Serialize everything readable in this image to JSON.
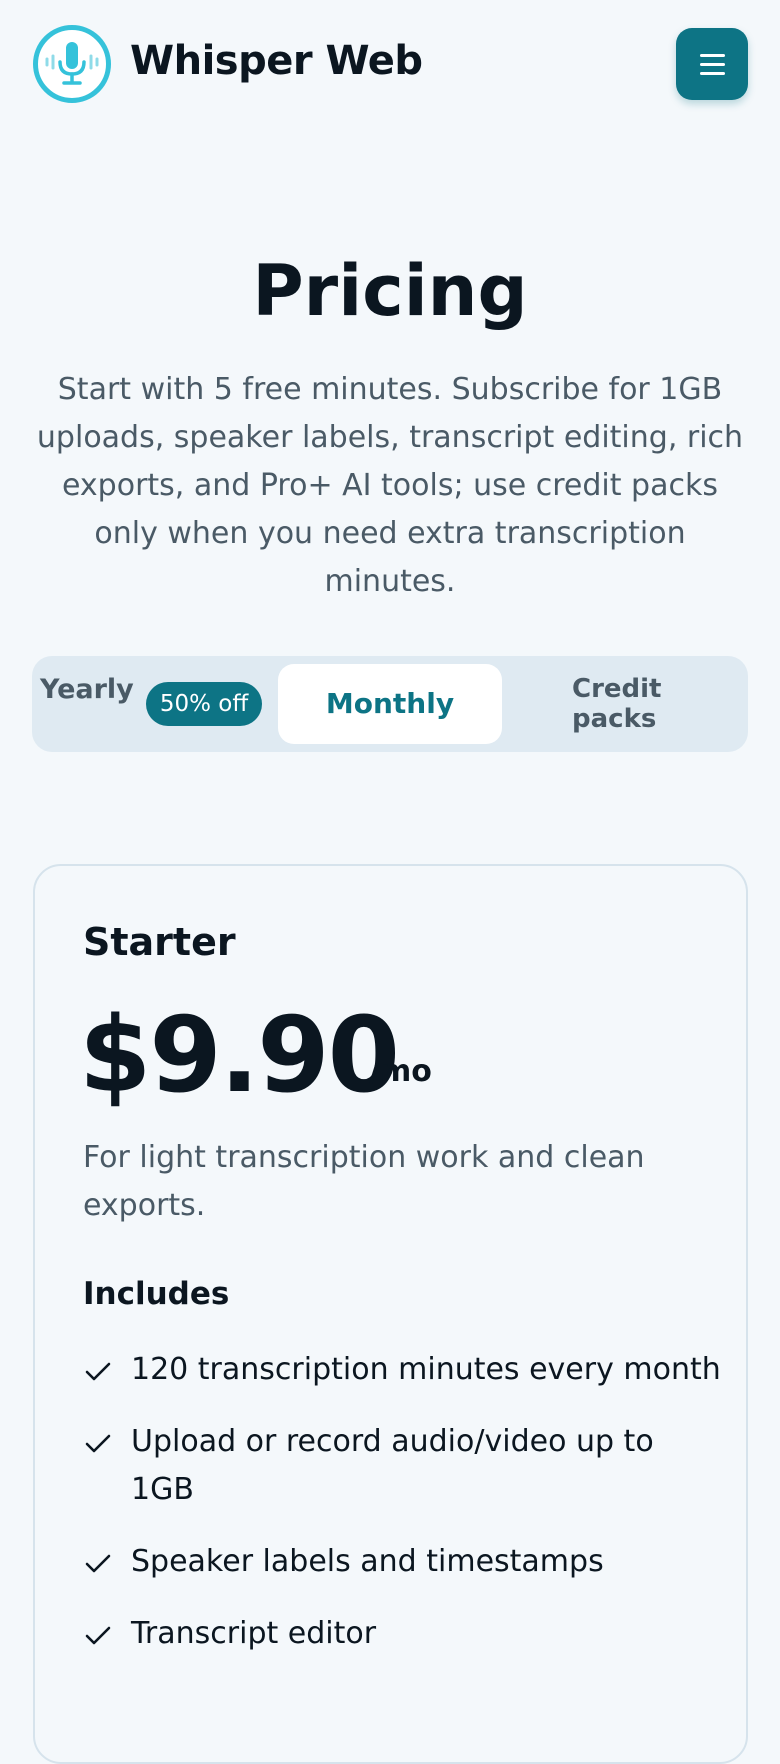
{
  "header": {
    "brand": "Whisper Web",
    "logo_icon": "microphone-soundwave-icon",
    "menu_icon": "hamburger-menu-icon",
    "accent_color": "#0d7485",
    "logo_color": "#35c2da"
  },
  "hero": {
    "title": "Pricing",
    "subtitle": "Start with 5 free minutes. Subscribe for 1GB uploads, speaker labels, transcript editing, rich exports, and Pro+ AI tools; use credit packs only when you need extra transcription minutes."
  },
  "billing_tabs": {
    "yearly": "Yearly",
    "yearly_badge": "50% off",
    "monthly": "Monthly",
    "credit_packs": "Credit packs",
    "selected": "Monthly"
  },
  "plan": {
    "name": "Starter",
    "price": "$9.90",
    "period": "/mo",
    "description": "For light transcription work and clean exports.",
    "includes_label": "Includes",
    "features": [
      "120 transcription minutes every month",
      "Upload or record audio/video up to 1GB",
      "Speaker labels and timestamps",
      "Transcript editor"
    ]
  }
}
